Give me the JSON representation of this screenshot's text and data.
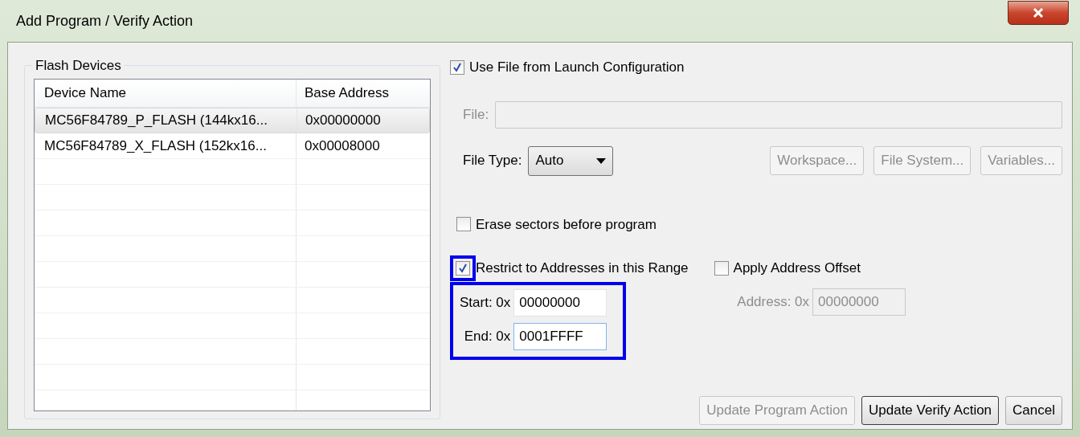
{
  "window": {
    "title": "Add Program / Verify Action"
  },
  "flash_devices": {
    "title": "Flash Devices",
    "columns": [
      "Device Name",
      "Base Address"
    ],
    "rows": [
      {
        "cells": [
          "MC56F84789_P_FLASH (144kx16...",
          "0x00000000"
        ],
        "selected": true
      },
      {
        "cells": [
          "MC56F84789_X_FLASH (152kx16...",
          "0x00008000"
        ],
        "selected": false
      }
    ]
  },
  "use_file": {
    "label": "Use File from Launch Configuration",
    "checked": true
  },
  "file": {
    "label": "File:",
    "disabled": true
  },
  "file_type": {
    "label": "File Type:",
    "value": "Auto"
  },
  "file_buttons": [
    {
      "label": "Workspace...",
      "disabled": true
    },
    {
      "label": "File System...",
      "disabled": true
    },
    {
      "label": "Variables...",
      "disabled": true
    }
  ],
  "erase": {
    "label": "Erase sectors before program",
    "checked": false
  },
  "restrict": {
    "label": "Restrict to Addresses in this Range",
    "checked": true,
    "highlighted": true
  },
  "apply_offset": {
    "label": "Apply Address Offset",
    "checked": false
  },
  "range": {
    "highlighted": true,
    "fields": [
      {
        "label": "Start: 0x",
        "value": "00000000",
        "focused": false
      },
      {
        "label": "End: 0x",
        "value": "0001FFFF",
        "focused": true
      }
    ]
  },
  "offset_address": {
    "label": "Address: 0x",
    "value": "00000000",
    "disabled": true
  },
  "buttons": [
    {
      "label": "Update Program Action",
      "disabled": true
    },
    {
      "label": "Update Verify Action",
      "disabled": false
    },
    {
      "label": "Cancel",
      "disabled": false
    }
  ]
}
